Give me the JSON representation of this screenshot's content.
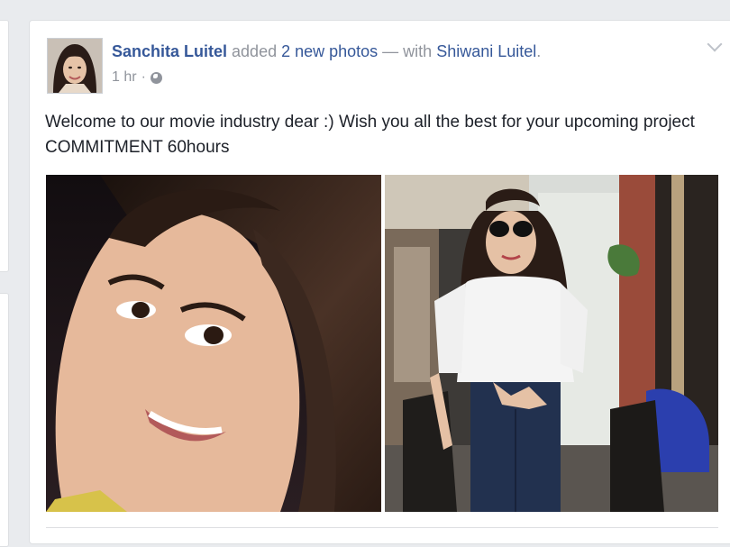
{
  "post": {
    "author": "Sanchita Luitel",
    "action": " added ",
    "photos_link": "2 new photos",
    "with_prefix": " — with ",
    "tagged": "Shiwani Luitel",
    "end": ".",
    "time": "1 hr",
    "separator": "·",
    "audience_icon": "globe-icon",
    "menu_icon": "chevron-down-icon",
    "text": "Welcome to our movie industry dear :) Wish you all the best for your upcoming project COMMITMENT 60hours"
  },
  "colors": {
    "link": "#365899",
    "meta": "#90949c",
    "background": "#e9ebee"
  }
}
